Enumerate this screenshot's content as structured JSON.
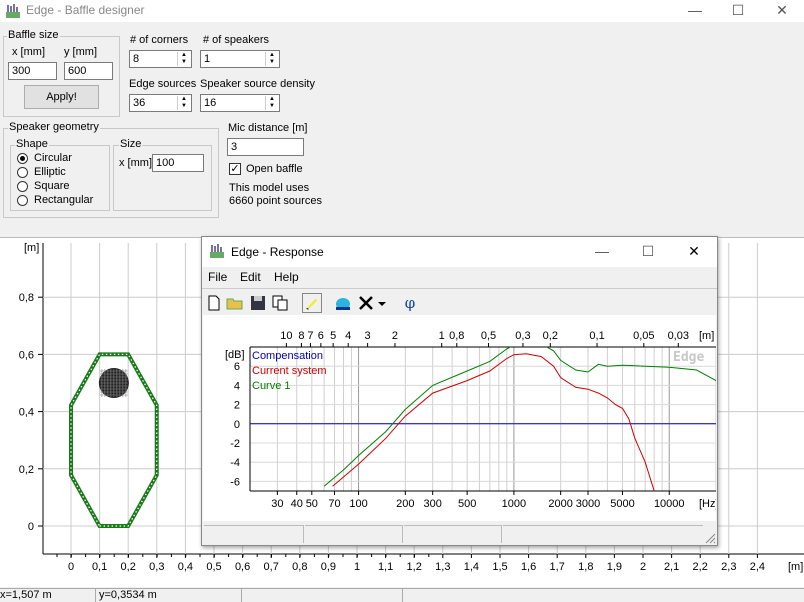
{
  "app": {
    "title": "Edge - Baffle designer",
    "window_controls": {
      "minimize": "—",
      "maximize": "☐",
      "close": "✕"
    }
  },
  "baffle_size": {
    "legend": "Baffle size",
    "x_label": "x [mm]",
    "y_label": "y [mm]",
    "x_value": "300",
    "y_value": "600",
    "apply_label": "Apply!"
  },
  "params": {
    "corners_label": "# of corners",
    "corners_value": "8",
    "speakers_label": "# of speakers",
    "speakers_value": "1",
    "edge_sources_label": "Edge sources",
    "edge_sources_value": "36",
    "density_label": "Speaker source density",
    "density_value": "16"
  },
  "speaker_geometry": {
    "legend": "Speaker geometry",
    "shape_legend": "Shape",
    "shapes": [
      "Circular",
      "Elliptic",
      "Square",
      "Rectangular"
    ],
    "selected_shape": "Circular",
    "size_legend": "Size",
    "size_x_label": "x [mm]",
    "size_x_value": "100"
  },
  "mic": {
    "label": "Mic distance [m]",
    "value": "3",
    "open_baffle_label": "Open baffle",
    "open_baffle_checked": true,
    "info_line1": "This model uses",
    "info_line2": "6660 point sources"
  },
  "baffle_plot": {
    "y_unit": "[m]",
    "x_unit": "[m]",
    "y_ticks": [
      "0,8",
      "0,6",
      "0,4",
      "0,2",
      "0"
    ],
    "x_ticks": [
      "0",
      "0,1",
      "0,2",
      "0,3",
      "0,4",
      "0,5",
      "0,6",
      "0,7",
      "0,8",
      "0,9",
      "1",
      "1,1",
      "1,2",
      "1,3",
      "1,4",
      "1,5",
      "1,6",
      "1,7",
      "1,8",
      "1,9",
      "2",
      "2,1",
      "2,2",
      "2,3",
      "2,4"
    ]
  },
  "status": {
    "x_readout": "x=1,507 m",
    "y_readout": "y=0,3534 m"
  },
  "response_window": {
    "title": "Edge - Response",
    "menu": [
      "File",
      "Edit",
      "Help"
    ],
    "toolbar": [
      "new-file-icon",
      "open-folder-icon",
      "save-icon",
      "copy-icon",
      "pen-icon",
      "blob-icon",
      "delete-icon",
      "dropdown-icon",
      "phi-icon"
    ],
    "phi_label": "φ",
    "watermark": "Edge"
  },
  "chart_data": {
    "type": "line",
    "title": "",
    "xlabel": "[Hz]",
    "ylabel": "[dB]",
    "x_scale": "log",
    "xlim": [
      20,
      20000
    ],
    "ylim": [
      -7,
      8
    ],
    "grid": true,
    "legend_position": "top-left",
    "x_tick_labels": [
      "30",
      "40",
      "50",
      "70",
      "100",
      "200",
      "300",
      "500",
      "1000",
      "2000",
      "3000",
      "5000",
      "10000"
    ],
    "y_tick_labels": [
      "6",
      "4",
      "2",
      "0",
      "-2",
      "-4",
      "-6"
    ],
    "top_axis_unit": "[m]",
    "top_axis_labels": [
      "10",
      "8",
      "7",
      "6",
      "5",
      "4",
      "3",
      "2",
      "1",
      "0,8",
      "0,5",
      "0,3",
      "0,2",
      "0,1",
      "0,05",
      "0,03"
    ],
    "series": [
      {
        "name": "Compensation",
        "color": "#0000c0",
        "x": [
          20,
          20000
        ],
        "y": [
          0,
          0
        ]
      },
      {
        "name": "Current system",
        "color": "#d00000",
        "x": [
          68,
          100,
          150,
          200,
          300,
          500,
          700,
          900,
          1000,
          1200,
          1500,
          1800,
          2000,
          2500,
          3000,
          3500,
          4000,
          4500,
          5000,
          5500,
          6000,
          7000,
          8000
        ],
        "y": [
          -6.5,
          -4.2,
          -1.5,
          0.8,
          3.2,
          4.5,
          5.5,
          6.8,
          7.2,
          7.3,
          7.0,
          6.0,
          4.8,
          3.8,
          3.6,
          3.2,
          2.7,
          2.0,
          1.6,
          0.5,
          -1.5,
          -4.0,
          -7.0
        ]
      },
      {
        "name": "Curve 1",
        "color": "#008000",
        "x": [
          60,
          80,
          100,
          150,
          200,
          300,
          500,
          700,
          900,
          1000,
          1200,
          1500,
          1800,
          2000,
          2500,
          3000,
          3500,
          4000,
          5000,
          7000,
          10000,
          15000,
          20000
        ],
        "y": [
          -6.5,
          -4.8,
          -3.3,
          -0.8,
          1.5,
          4.0,
          5.5,
          6.5,
          7.8,
          8.2,
          8.4,
          8.3,
          7.6,
          6.6,
          5.6,
          5.4,
          6.2,
          6.0,
          6.1,
          6.0,
          5.9,
          5.6,
          4.5
        ]
      }
    ]
  }
}
